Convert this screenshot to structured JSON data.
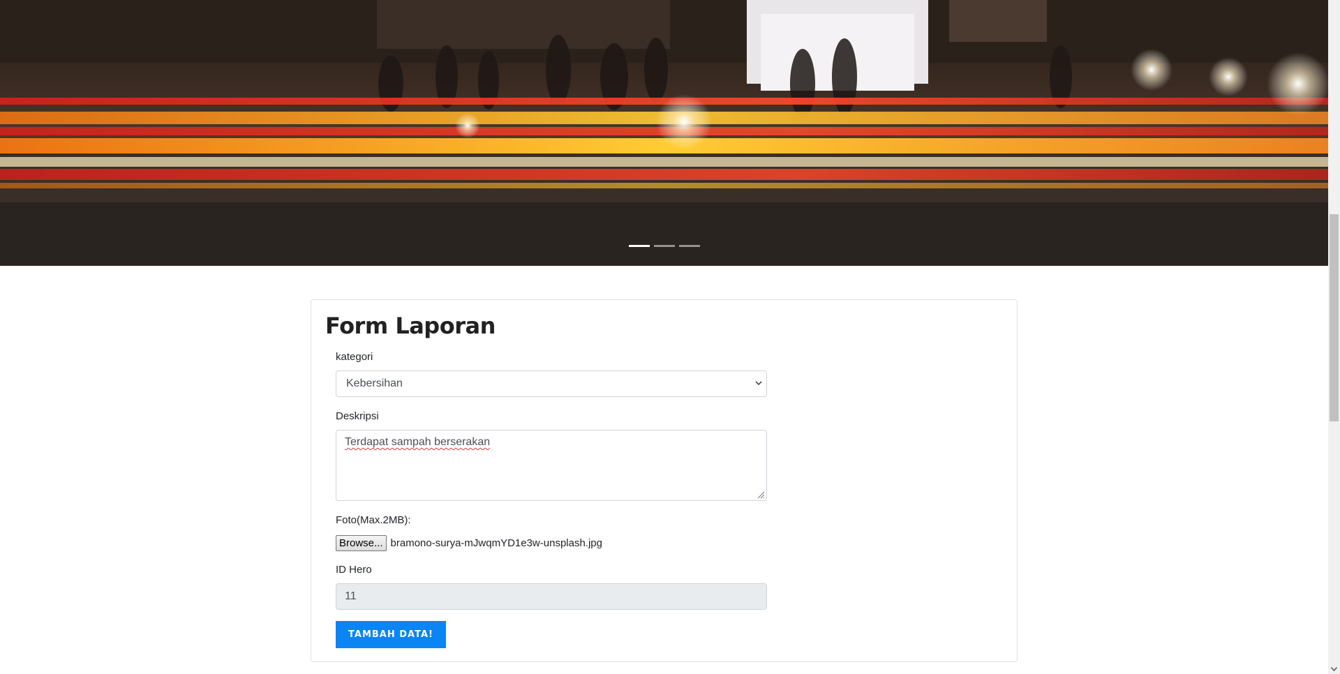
{
  "hero": {
    "image": "city-night-traffic-light-trails-photo",
    "indicators": [
      {
        "active": true
      },
      {
        "active": false
      },
      {
        "active": false
      }
    ]
  },
  "form": {
    "title": "Form Laporan",
    "kategori_label": "kategori",
    "kategori_value": "Kebersihan",
    "deskripsi_label": "Deskripsi",
    "deskripsi_value": "Terdapat sampah berserakan",
    "foto_label": "Foto(Max.2MB):",
    "browse_label": "Browse...",
    "file_name": "bramono-surya-mJwqmYD1e3w-unsplash.jpg",
    "idhero_label": "ID Hero",
    "idhero_value": "11",
    "submit_label": "TAMBAH DATA!"
  },
  "colors": {
    "accent": "#0b84f4",
    "readonly_bg": "#e9ecef"
  }
}
